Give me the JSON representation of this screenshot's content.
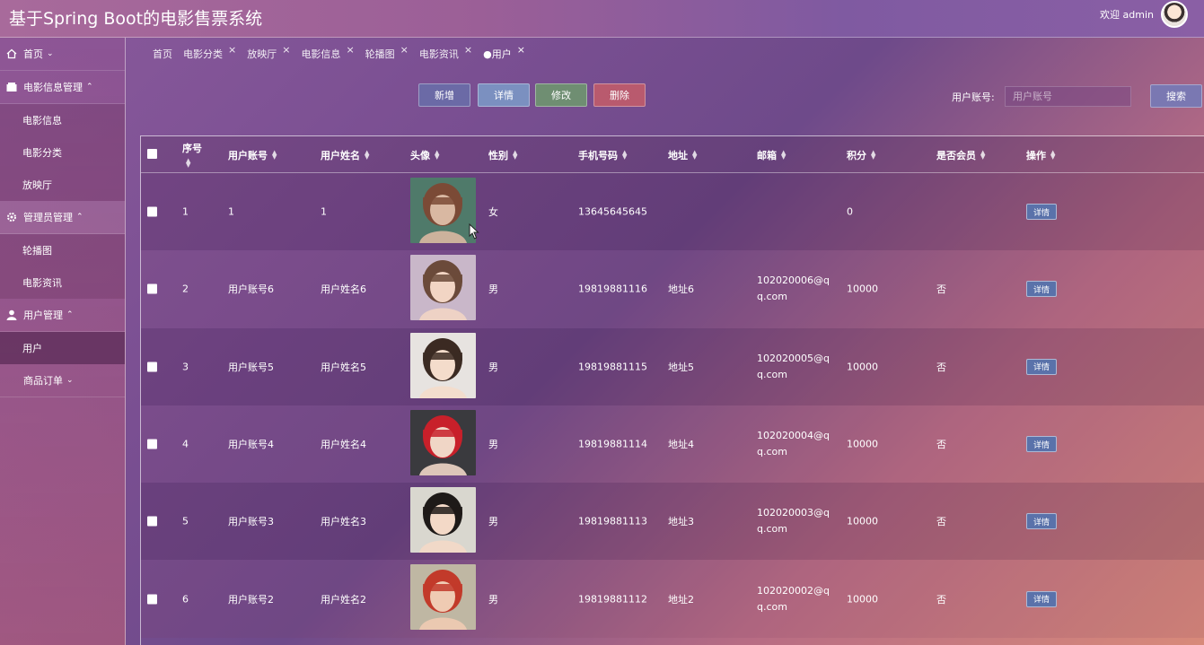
{
  "app": {
    "title": "基于Spring Boot的电影售票系统",
    "welcome": "欢迎 admin"
  },
  "sidebar": {
    "items": [
      {
        "type": "group",
        "label": "首页",
        "icon": "home-icon",
        "chevron": "⌄"
      },
      {
        "type": "group",
        "label": "电影信息管理",
        "icon": "film-icon",
        "chevron": "⌃"
      },
      {
        "type": "sub",
        "label": "电影信息"
      },
      {
        "type": "sub",
        "label": "电影分类"
      },
      {
        "type": "sub",
        "label": "放映厅"
      },
      {
        "type": "group",
        "label": "管理员管理",
        "icon": "gear-icon",
        "chevron": "⌃"
      },
      {
        "type": "sub",
        "label": "轮播图"
      },
      {
        "type": "sub",
        "label": "电影资讯"
      },
      {
        "type": "group",
        "label": "用户管理",
        "icon": "user-icon",
        "chevron": "⌃"
      },
      {
        "type": "sub",
        "label": "用户",
        "active": true
      },
      {
        "type": "group",
        "label": "商品订单",
        "icon": "",
        "chevron": "⌄"
      }
    ]
  },
  "tabs": [
    {
      "label": "首页",
      "closable": false
    },
    {
      "label": "电影分类",
      "closable": true
    },
    {
      "label": "放映厅",
      "closable": true
    },
    {
      "label": "电影信息",
      "closable": true
    },
    {
      "label": "轮播图",
      "closable": true
    },
    {
      "label": "电影资讯",
      "closable": true
    },
    {
      "label": "●用户",
      "closable": true,
      "active": true
    }
  ],
  "toolbar": {
    "add": "新增",
    "detail": "详情",
    "edit": "修改",
    "delete": "删除"
  },
  "search": {
    "label": "用户账号:",
    "placeholder": "用户账号",
    "button": "搜索"
  },
  "table": {
    "headers": [
      "序号",
      "用户账号",
      "用户姓名",
      "头像",
      "性别",
      "手机号码",
      "地址",
      "邮箱",
      "积分",
      "是否会员",
      "操作"
    ],
    "detail_label": "详情",
    "rows": [
      {
        "no": "1",
        "account": "1",
        "name": "1",
        "gender": "女",
        "phone": "13645645645",
        "address": "",
        "email": "",
        "points": "0",
        "member": ""
      },
      {
        "no": "2",
        "account": "用户账号6",
        "name": "用户姓名6",
        "gender": "男",
        "phone": "19819881116",
        "address": "地址6",
        "email": "102020006@qq.com",
        "points": "10000",
        "member": "否"
      },
      {
        "no": "3",
        "account": "用户账号5",
        "name": "用户姓名5",
        "gender": "男",
        "phone": "19819881115",
        "address": "地址5",
        "email": "102020005@qq.com",
        "points": "10000",
        "member": "否"
      },
      {
        "no": "4",
        "account": "用户账号4",
        "name": "用户姓名4",
        "gender": "男",
        "phone": "19819881114",
        "address": "地址4",
        "email": "102020004@qq.com",
        "points": "10000",
        "member": "否"
      },
      {
        "no": "5",
        "account": "用户账号3",
        "name": "用户姓名3",
        "gender": "男",
        "phone": "19819881113",
        "address": "地址3",
        "email": "102020003@qq.com",
        "points": "10000",
        "member": "否"
      },
      {
        "no": "6",
        "account": "用户账号2",
        "name": "用户姓名2",
        "gender": "男",
        "phone": "19819881112",
        "address": "地址2",
        "email": "102020002@qq.com",
        "points": "10000",
        "member": "否"
      }
    ]
  },
  "colors": {
    "accent_add": "#6b6aa6",
    "accent_detail": "#7b90c0",
    "accent_edit": "#6f8e72",
    "accent_delete": "#b95a6e"
  }
}
